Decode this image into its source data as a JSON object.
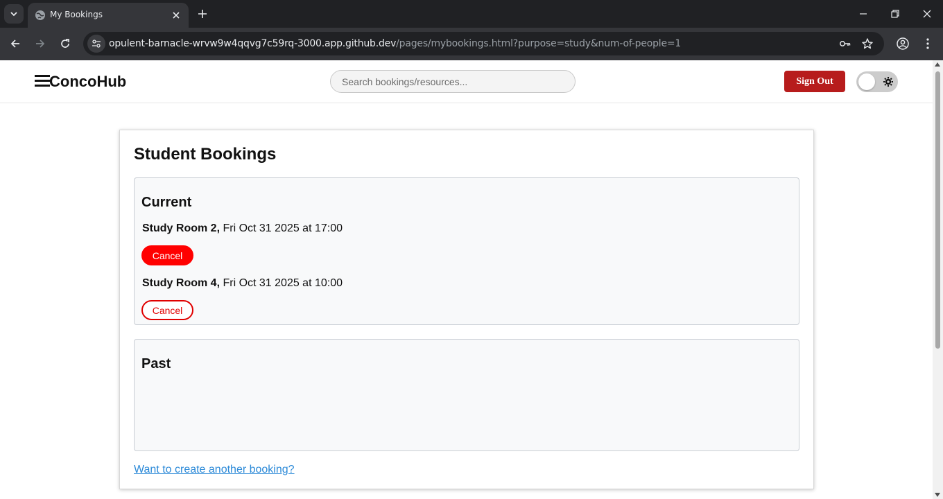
{
  "browser": {
    "tab_title": "My Bookings",
    "url_host": "opulent-barnacle-wrvw9w4qqvg7c59rq-3000.app.github.dev",
    "url_path": "/pages/mybookings.html?purpose=study&num-of-people=1"
  },
  "header": {
    "brand": "ConcoHub",
    "search_placeholder": "Search bookings/resources...",
    "sign_out_label": "Sign Out",
    "theme_toggle_state": "off"
  },
  "page": {
    "title": "Student Bookings",
    "current_section_title": "Current",
    "past_section_title": "Past",
    "current_bookings": [
      {
        "room": "Study Room 2,",
        "when": " Fri Oct 31 2025 at 17:00",
        "cancel_label": "Cancel"
      },
      {
        "room": "Study Room 4,",
        "when": " Fri Oct 31 2025 at 10:00",
        "cancel_label": "Cancel"
      }
    ],
    "create_link": "Want to create another booking?"
  },
  "colors": {
    "signout_bg": "#b71c1c",
    "cancel_red": "#ff0000",
    "link_blue": "#2c8ad8"
  }
}
